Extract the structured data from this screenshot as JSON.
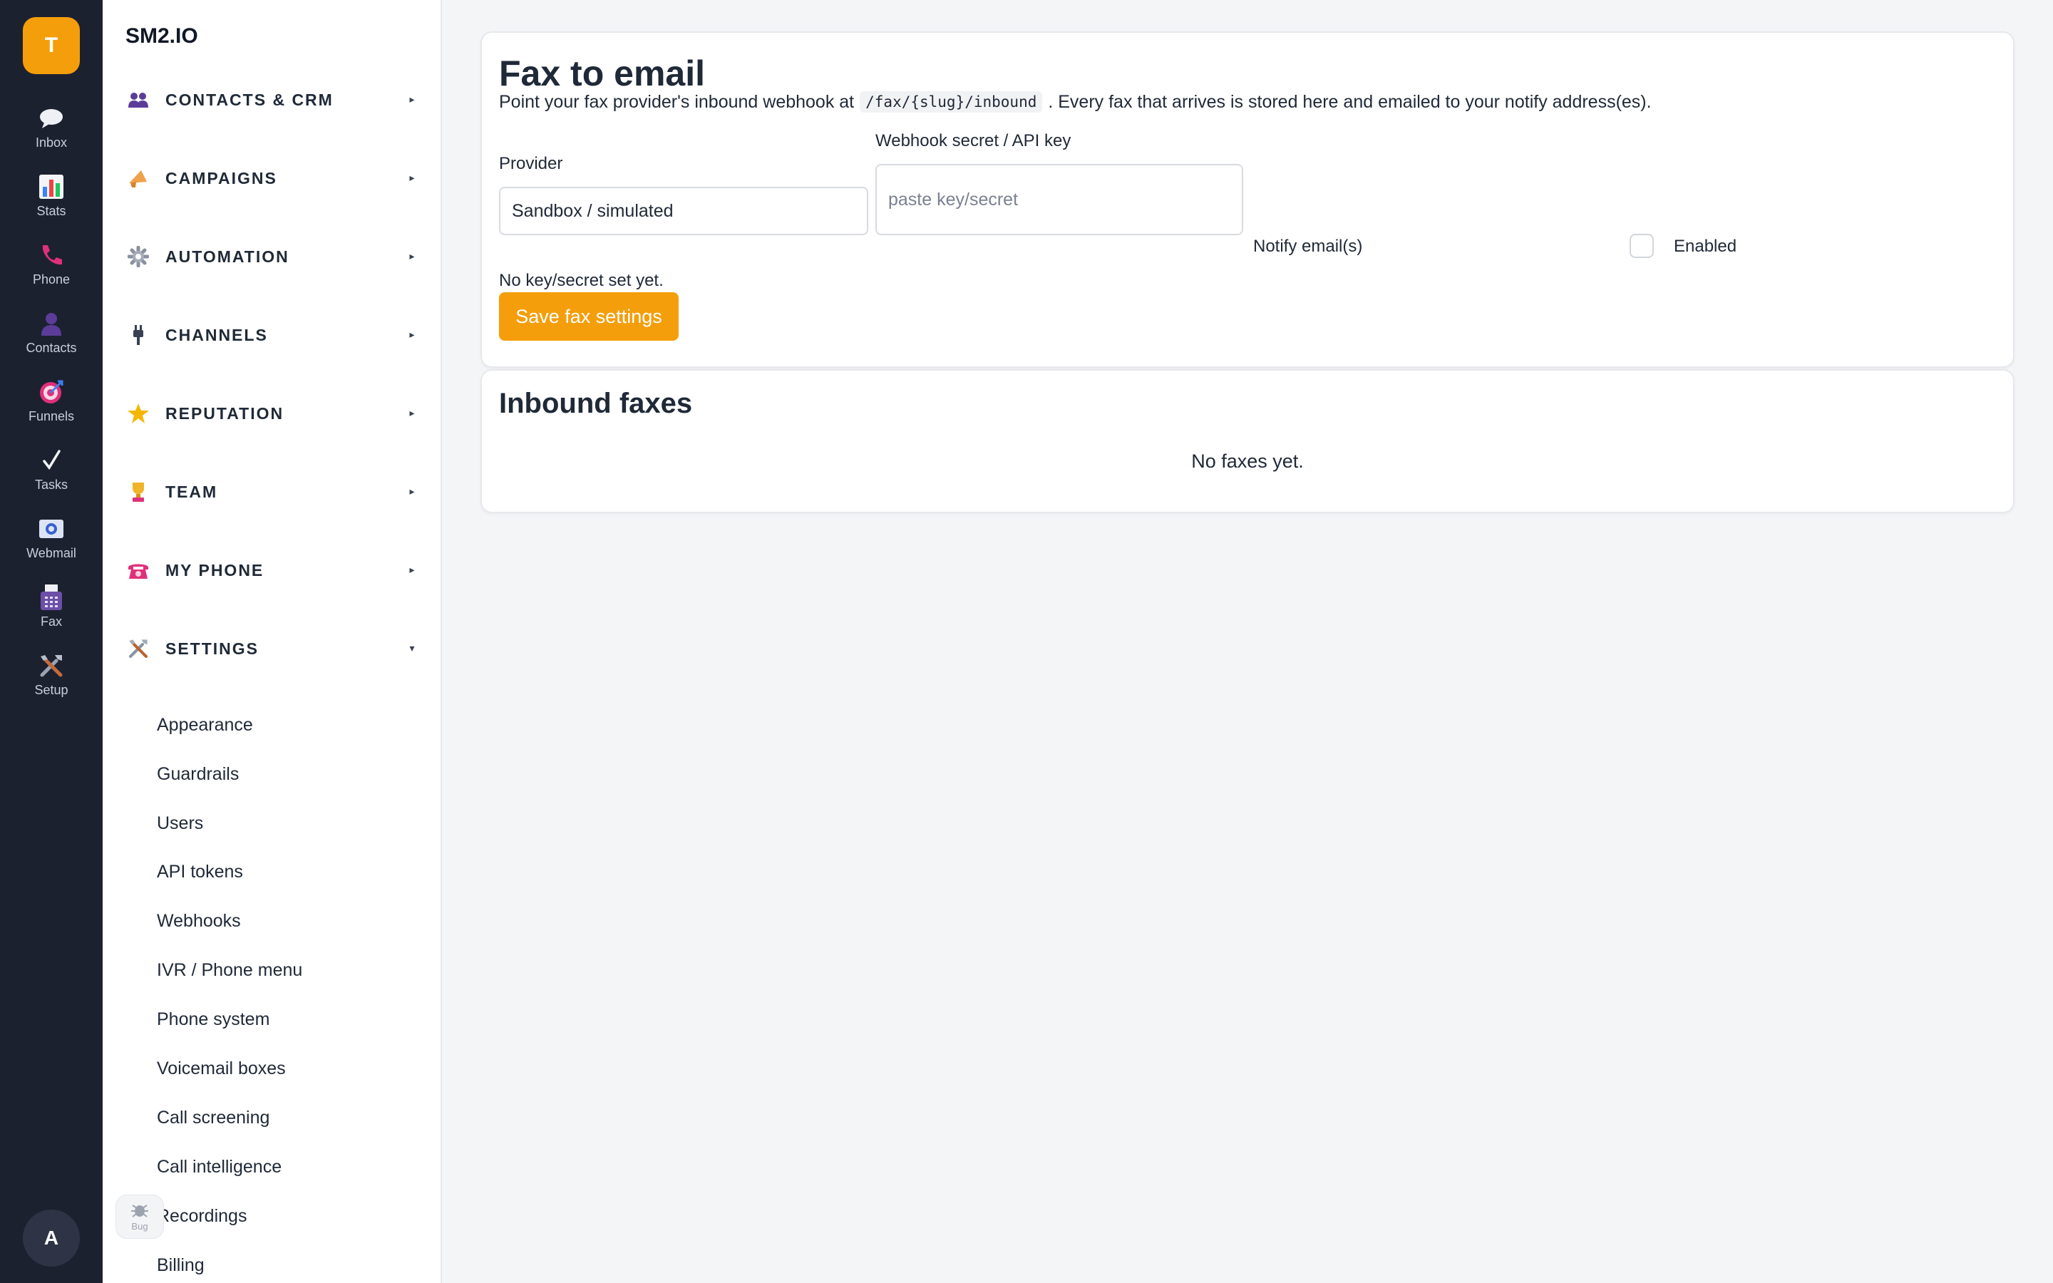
{
  "rail": {
    "workspace_initial": "T",
    "items": [
      {
        "label": "Inbox",
        "icon": "chat-bubble-icon"
      },
      {
        "label": "Stats",
        "icon": "bar-chart-icon"
      },
      {
        "label": "Phone",
        "icon": "phone-icon"
      },
      {
        "label": "Contacts",
        "icon": "person-icon"
      },
      {
        "label": "Funnels",
        "icon": "target-icon"
      },
      {
        "label": "Tasks",
        "icon": "checkmark-icon"
      },
      {
        "label": "Webmail",
        "icon": "mail-icon"
      },
      {
        "label": "Fax",
        "icon": "fax-icon"
      },
      {
        "label": "Setup",
        "icon": "tools-icon"
      }
    ],
    "avatar_initial": "A"
  },
  "sidebar": {
    "brand": "SM2.IO",
    "sections": [
      {
        "label": "CONTACTS & CRM",
        "icon": "people-icon",
        "caret": "▸"
      },
      {
        "label": "CAMPAIGNS",
        "icon": "megaphone-icon",
        "caret": "▸"
      },
      {
        "label": "AUTOMATION",
        "icon": "gear-icon",
        "caret": "▸"
      },
      {
        "label": "CHANNELS",
        "icon": "plug-icon",
        "caret": "▸"
      },
      {
        "label": "REPUTATION",
        "icon": "star-icon",
        "caret": "▸"
      },
      {
        "label": "TEAM",
        "icon": "trophy-icon",
        "caret": "▸"
      },
      {
        "label": "MY PHONE",
        "icon": "telephone-icon",
        "caret": "▸"
      },
      {
        "label": "SETTINGS",
        "icon": "tools-icon",
        "caret": "▾"
      }
    ],
    "settings_items": [
      "Appearance",
      "Guardrails",
      "Users",
      "API tokens",
      "Webhooks",
      "IVR / Phone menu",
      "Phone system",
      "Voicemail boxes",
      "Call screening",
      "Call intelligence",
      "Recordings",
      "Billing"
    ],
    "bug_label": "Bug"
  },
  "fax_settings": {
    "title": "Fax to email",
    "desc_before": "Point your fax provider's inbound webhook at",
    "desc_code": "/fax/{slug}/inbound",
    "desc_after": ". Every fax that arrives is stored here and emailed to your notify address(es).",
    "provider_label": "Provider",
    "provider_value": "Sandbox / simulated",
    "secret_label": "Webhook secret / API key",
    "secret_placeholder": "paste key/secret",
    "notify_label": "Notify email(s)",
    "enabled_label": "Enabled",
    "enabled": false,
    "key_status": "No key/secret set yet.",
    "save_label": "Save fax settings"
  },
  "inbound": {
    "title": "Inbound faxes",
    "empty_text": "No faxes yet."
  },
  "colors": {
    "accent": "#f59e0b",
    "rail_bg": "#1c2130",
    "page_bg": "#f4f5f7"
  }
}
